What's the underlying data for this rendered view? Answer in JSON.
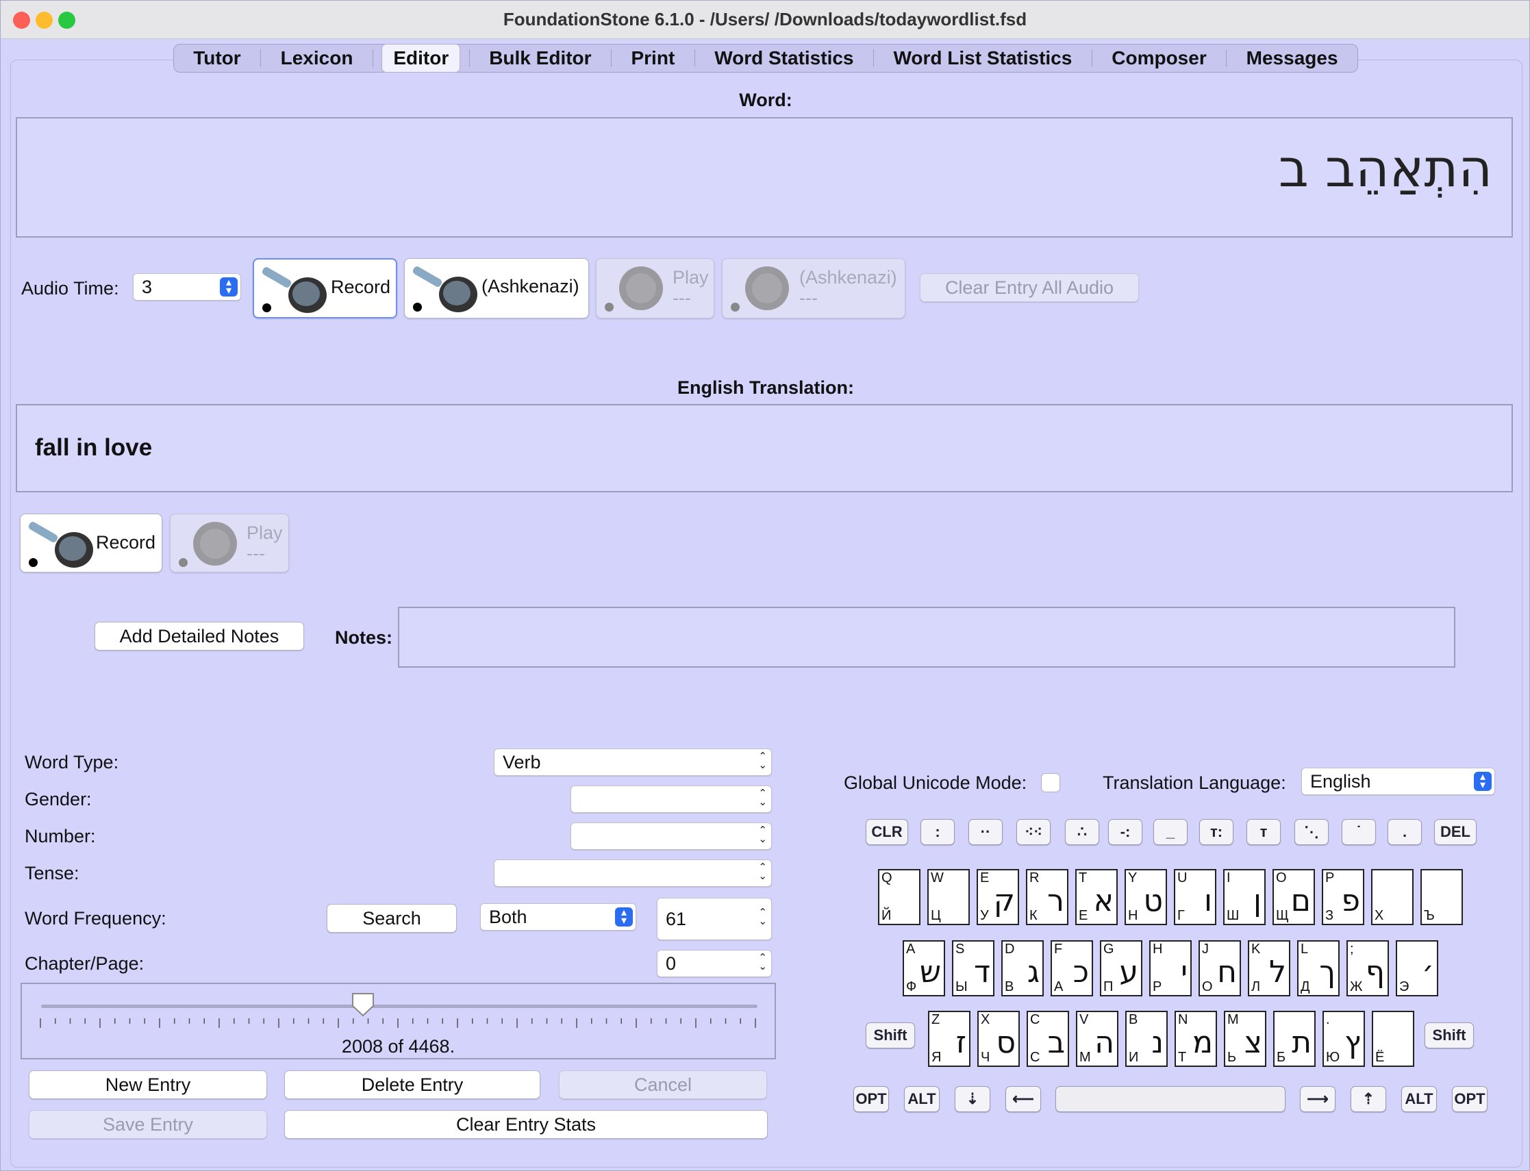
{
  "window": {
    "title": "FoundationStone 6.1.0 - /Users/      /Downloads/todaywordlist.fsd"
  },
  "tabs": [
    "Tutor",
    "Lexicon",
    "Editor",
    "Bulk Editor",
    "Print",
    "Word Statistics",
    "Word List Statistics",
    "Composer",
    "Messages"
  ],
  "selected_tab": "Editor",
  "word": {
    "label": "Word:",
    "value": "הִתְאַהֵב ב"
  },
  "audio": {
    "time_label": "Audio Time:",
    "time_value": "3",
    "record_label": "Record",
    "ashkenazi_label": "(Ashkenazi)",
    "play_label": "Play",
    "play_ash_label": "(Ashkenazi)",
    "dashes": "---",
    "clear_all_label": "Clear Entry All Audio"
  },
  "translation": {
    "label": "English Translation:",
    "value": "fall in love",
    "record_label": "Record",
    "play_label": "Play",
    "dashes": "---"
  },
  "notes": {
    "add_button": "Add Detailed Notes",
    "label": "Notes:",
    "value": ""
  },
  "form": {
    "word_type_label": "Word Type:",
    "word_type_value": "Verb",
    "gender_label": "Gender:",
    "gender_value": "",
    "number_label": "Number:",
    "number_value": "",
    "tense_label": "Tense:",
    "tense_value": "",
    "frequency_label": "Word Frequency:",
    "search_button": "Search",
    "frequency_scope": "Both",
    "frequency_value": "61",
    "chapter_label": "Chapter/Page:",
    "chapter_value": "0"
  },
  "slider": {
    "position": 2008,
    "total": 4468,
    "caption": "2008 of 4468."
  },
  "actions": {
    "new_entry": "New Entry",
    "delete_entry": "Delete Entry",
    "cancel": "Cancel",
    "save_entry": "Save Entry",
    "clear_stats": "Clear Entry Stats"
  },
  "keyboard": {
    "unicode_label": "Global Unicode Mode:",
    "language_label": "Translation Language:",
    "language_value": "English",
    "clr": "CLR",
    "del": "DEL",
    "shift": "Shift",
    "opt": "OPT",
    "alt": "ALT",
    "row1": [
      {
        "en": "Q",
        "ru": "Й",
        "he": ""
      },
      {
        "en": "W",
        "ru": "Ц",
        "he": ""
      },
      {
        "en": "E",
        "ru": "У",
        "he": "ק"
      },
      {
        "en": "R",
        "ru": "К",
        "he": "ר"
      },
      {
        "en": "T",
        "ru": "Е",
        "he": "א"
      },
      {
        "en": "Y",
        "ru": "Н",
        "he": "ט"
      },
      {
        "en": "U",
        "ru": "Г",
        "he": "ו"
      },
      {
        "en": "I",
        "ru": "Ш",
        "he": "ן"
      },
      {
        "en": "O",
        "ru": "Щ",
        "he": "ם"
      },
      {
        "en": "P",
        "ru": "З",
        "he": "פ"
      },
      {
        "en": "",
        "ru": "Х",
        "he": ""
      },
      {
        "en": "",
        "ru": "Ъ",
        "he": ""
      }
    ],
    "row2": [
      {
        "en": "A",
        "ru": "Ф",
        "he": "ש"
      },
      {
        "en": "S",
        "ru": "Ы",
        "he": "ד"
      },
      {
        "en": "D",
        "ru": "В",
        "he": "ג"
      },
      {
        "en": "F",
        "ru": "А",
        "he": "כ"
      },
      {
        "en": "G",
        "ru": "П",
        "he": "ע"
      },
      {
        "en": "H",
        "ru": "Р",
        "he": "י"
      },
      {
        "en": "J",
        "ru": "О",
        "he": "ח"
      },
      {
        "en": "K",
        "ru": "Л",
        "he": "ל"
      },
      {
        "en": "L",
        "ru": "Д",
        "he": "ך"
      },
      {
        "en": ";",
        "ru": "Ж",
        "he": "ף"
      },
      {
        "en": "",
        "ru": "Э",
        "he": "׳"
      }
    ],
    "row3": [
      {
        "en": "Z",
        "ru": "Я",
        "he": "ז"
      },
      {
        "en": "X",
        "ru": "Ч",
        "he": "ס"
      },
      {
        "en": "C",
        "ru": "С",
        "he": "ב"
      },
      {
        "en": "V",
        "ru": "М",
        "he": "ה"
      },
      {
        "en": "B",
        "ru": "И",
        "he": "נ"
      },
      {
        "en": "N",
        "ru": "Т",
        "he": "מ"
      },
      {
        "en": "M",
        "ru": "Ь",
        "he": "צ"
      },
      {
        "en": "",
        "ru": "Б",
        "he": "ת"
      },
      {
        "en": ".",
        "ru": "Ю",
        "he": "ץ"
      },
      {
        "en": "",
        "ru": "Ё",
        "he": ""
      }
    ]
  },
  "colors": {
    "background": "#d3d3fb",
    "accent": "#2a6df2"
  }
}
